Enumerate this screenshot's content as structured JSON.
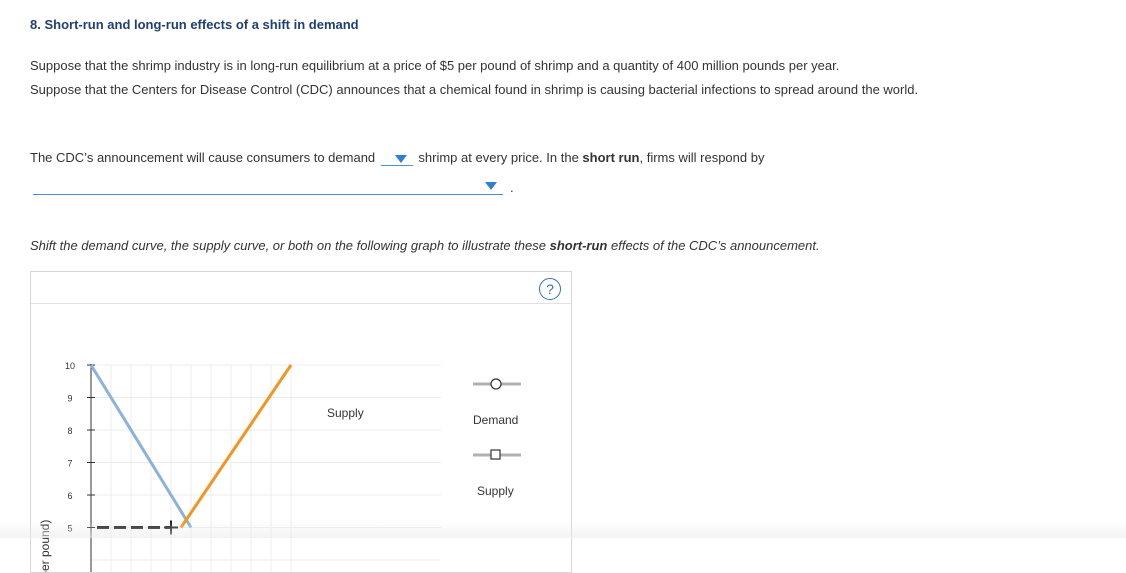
{
  "heading": "8. Short-run and long-run effects of a shift in demand",
  "paragraph1": "Suppose that the shrimp industry is in long-run equilibrium at a price of $5 per pound of shrimp and a quantity of 400 million pounds per year.",
  "paragraph2": "Suppose that the Centers for Disease Control (CDC) announces that a chemical found in shrimp is causing bacterial infections to spread around the world.",
  "question": {
    "part1": "The CDC’s announcement will cause consumers to demand",
    "part2": "shrimp at every price. In the ",
    "bold": "short run",
    "part3": ", firms will respond by",
    "dropdown1_value": "",
    "dropdown2_value": "",
    "period": "."
  },
  "instruction": {
    "part1": "Shift the demand curve, the supply curve, or both on the following graph to illustrate these ",
    "bold": "short-run",
    "part2": " effects of the CDC’s announcement."
  },
  "help_icon": "?",
  "chart_data": {
    "type": "line",
    "ylabel": "Price (Dollars per pound)",
    "ylabel_visible": "lars per pound)",
    "y_ticks": [
      10,
      9,
      8,
      7,
      6,
      5
    ],
    "series": [
      {
        "name": "Demand",
        "color": "#8ab2dc",
        "points": [
          [
            0,
            10
          ],
          [
            500,
            5
          ]
        ]
      },
      {
        "name": "Supply",
        "color": "#f5941e",
        "points": [
          [
            450,
            5
          ],
          [
            1000,
            10
          ]
        ]
      }
    ],
    "equilibrium": {
      "price": 5,
      "quantity": 400
    },
    "curve_labels": {
      "supply": "Supply"
    },
    "legend": [
      "Demand",
      "Supply"
    ]
  },
  "colors": {
    "heading": "#1f3f74",
    "dropdown_line": "#4a8ed8",
    "dropdown_arrow": "#2f7fd4",
    "demand": "#8ab2dc",
    "supply": "#f5941e"
  }
}
